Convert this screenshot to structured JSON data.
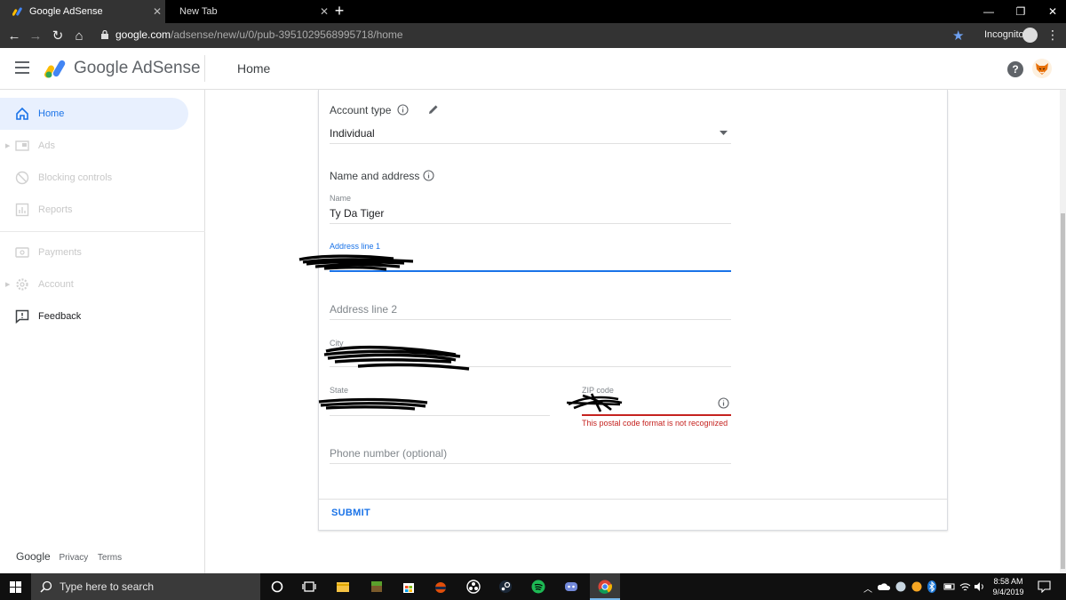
{
  "browser": {
    "tabs": [
      {
        "label": "Google AdSense",
        "active": true
      },
      {
        "label": "New Tab",
        "active": false
      }
    ],
    "new_tab": "+",
    "url_host": "google.com",
    "url_path": "/adsense/new/u/0/pub-3951029568995718/home",
    "incognito_label": "Incognito"
  },
  "app": {
    "brand": "Google AdSense",
    "page_title": "Home"
  },
  "sidebar": {
    "items": [
      {
        "label": "Home",
        "icon": "home-icon",
        "state": "active"
      },
      {
        "label": "Ads",
        "icon": "ads-icon",
        "state": "disabled"
      },
      {
        "label": "Blocking controls",
        "icon": "block-icon",
        "state": "disabled"
      },
      {
        "label": "Reports",
        "icon": "reports-icon",
        "state": "disabled"
      },
      {
        "label": "Payments",
        "icon": "payments-icon",
        "state": "disabled"
      },
      {
        "label": "Account",
        "icon": "gear-icon",
        "state": "disabled"
      },
      {
        "label": "Feedback",
        "icon": "feedback-icon",
        "state": "enabled"
      }
    ],
    "footer": {
      "brand": "Google",
      "privacy": "Privacy",
      "terms": "Terms"
    }
  },
  "form": {
    "account_type": {
      "title": "Account type",
      "value": "Individual"
    },
    "name_address_title": "Name and address",
    "name": {
      "label": "Name",
      "value": "Ty Da Tiger"
    },
    "address1": {
      "label": "Address line 1"
    },
    "address2": {
      "placeholder": "Address line 2"
    },
    "city": {
      "label": "City"
    },
    "state": {
      "label": "State"
    },
    "zip": {
      "label": "ZIP code",
      "error": "This postal code format is not recognized"
    },
    "phone": {
      "placeholder": "Phone number (optional)"
    },
    "submit": "SUBMIT"
  },
  "colors": {
    "accent": "#1a73e8",
    "error": "#c5221f",
    "active_bg": "#e8f0fe"
  },
  "taskbar": {
    "search_placeholder": "Type here to search",
    "time": "8:58 AM",
    "date": "9/4/2019"
  }
}
